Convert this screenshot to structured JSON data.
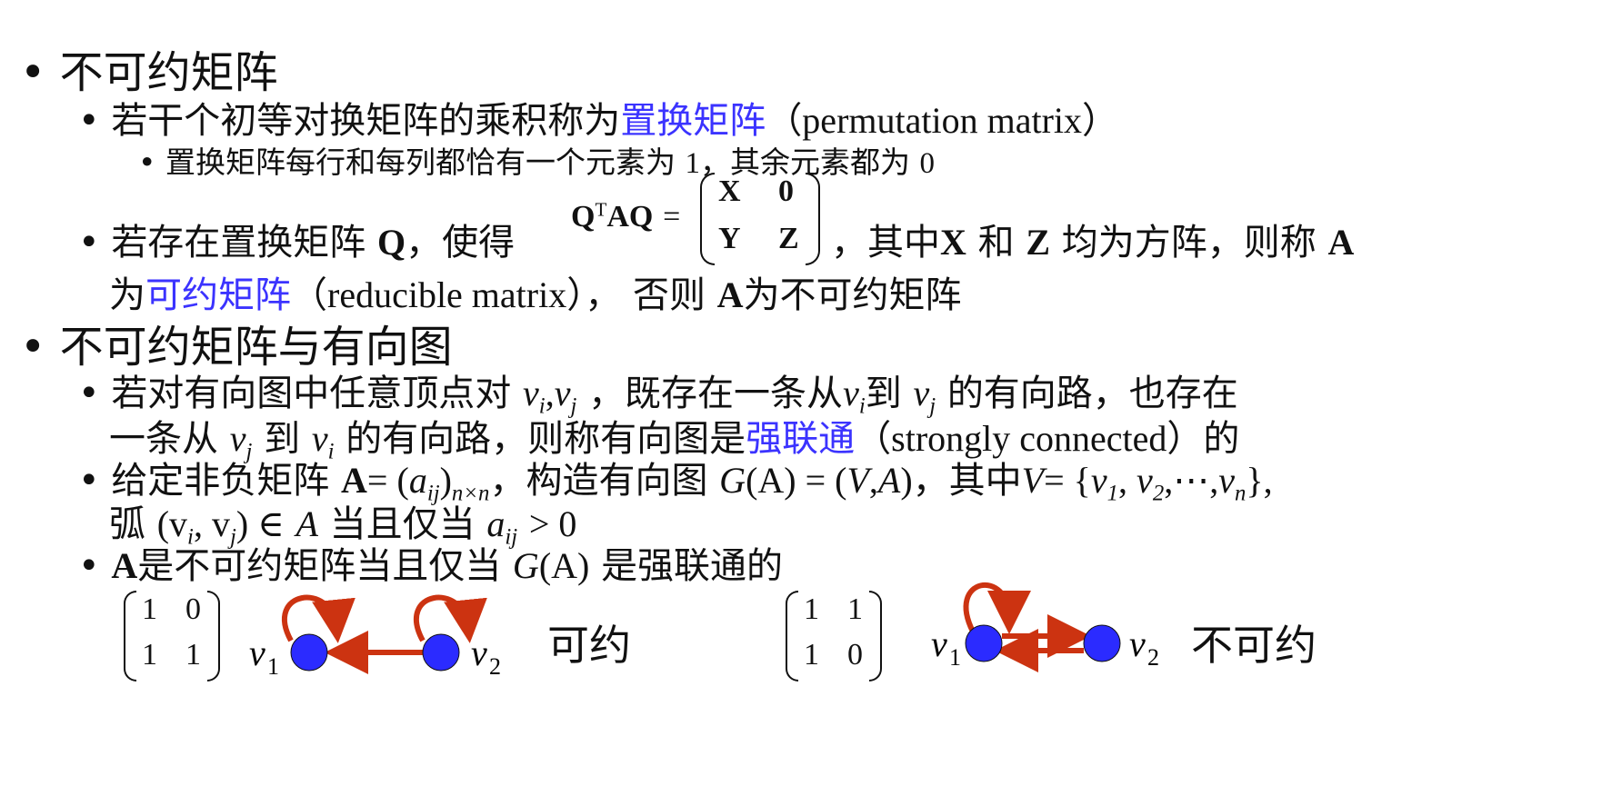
{
  "bullet1": {
    "glyph": "•",
    "text": "不可约矩阵"
  },
  "permutation": {
    "prefix": "若干个初等对换矩阵的乘积称为",
    "term": "置换矩阵",
    "en": "（permutation matrix）"
  },
  "permutation_note": {
    "prefix": "置换矩阵每行和每列都恰有一个元素为",
    "one": "1",
    "mid": "，其余元素都为",
    "zero": "0"
  },
  "reducible_def": {
    "prefix": "若存在置换矩阵",
    "Q": "Q",
    "comma": "，使得",
    "formula_lhs_Q": "Q",
    "formula_T": "T",
    "formula_AQ": "AQ",
    "eq": "=",
    "matrix_cells": [
      "X",
      "0",
      "Y",
      "Z"
    ],
    "after": "，其中",
    "X": "X",
    "and": "和",
    "Z": "Z",
    "square": "均为方阵，则称",
    "A": "A",
    "line2_prefix": "为",
    "term": "可约矩阵",
    "en": "（reducible matrix），",
    "otherwise": "否则",
    "A2": "A",
    "tail": "为不可约矩阵"
  },
  "bullet2": {
    "text": "不可约矩阵与有向图"
  },
  "strong": {
    "p1": "若对有向图中任意顶点对",
    "p2": "，既存在一条从",
    "p3": "到",
    "p4": "的有向路，也存在",
    "l2a": "一条从",
    "l2b": "到",
    "l2c": "的有向路，则称有向图是",
    "term": "强联通",
    "en": "（strongly connected）的",
    "vi": "v",
    "vj": "v",
    "i": "i",
    "j": "j"
  },
  "construct": {
    "p1": "给定非负矩阵",
    "A": "A",
    "eq": "= (",
    "a": "a",
    "ij": "ij",
    "close": ")",
    "nxn": "n×n",
    "p2": "，构造有向图",
    "G": "G",
    "GA": "(A) = (",
    "V": "V",
    "comma": ",",
    "Aset": "A",
    "close2": ")",
    "p3": "，其中",
    "Vset": "V",
    "eq2": "= {",
    "v1": "v",
    "one": "1",
    "two": "2",
    "dots": ", v",
    "n": "n",
    "ell": ",⋯,",
    "end": "},",
    "l2a": "弧",
    "arc": "(v",
    "arc2": ", v",
    "in": ") ∈",
    "l2b": "当且仅当",
    "gt": "> 0"
  },
  "iff": {
    "A": "A",
    "p1": "是不可约矩阵当且仅当",
    "G": "G",
    "GA": "(A)",
    "p2": "是强联通的"
  },
  "example1": {
    "matrix": [
      "1",
      "0",
      "1",
      "1"
    ],
    "v1": "v",
    "v1_sub": "1",
    "v2": "v",
    "v2_sub": "2",
    "caption": "可约"
  },
  "example2": {
    "matrix": [
      "1",
      "1",
      "1",
      "0"
    ],
    "v1": "v",
    "v1_sub": "1",
    "v2": "v",
    "v2_sub": "2",
    "caption": "不可约"
  },
  "colors": {
    "term_blue": "#3b33ff",
    "node_blue": "#2b2bff",
    "arrow_red": "#cc3311"
  },
  "icons": {
    "bullet": "bullet-dot"
  }
}
